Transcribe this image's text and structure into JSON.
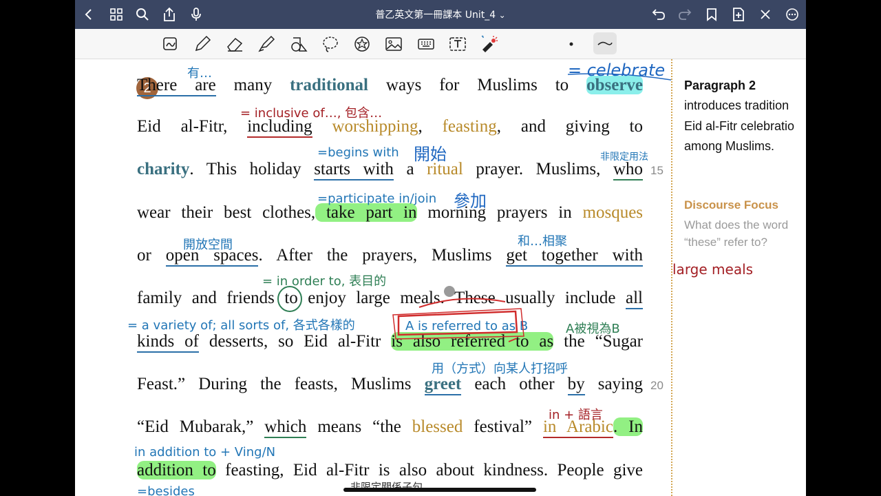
{
  "window": {
    "title": "普乙英文第一冊課本 Unit_4",
    "title_chevron": "⌄"
  },
  "titlebar_icons": [
    "back-chevron-icon",
    "grid-icon",
    "search-icon",
    "share-icon",
    "microphone-icon",
    "undo-icon",
    "redo-icon",
    "bookmark-icon",
    "add-page-icon",
    "close-pen-icon",
    "more-icon"
  ],
  "toolbar_icons": [
    "scan-icon",
    "pen-icon",
    "eraser-icon",
    "highlighter-icon",
    "shapes-icon",
    "lasso-icon",
    "sticker-icon",
    "image-icon",
    "keyboard-icon",
    "text-box-icon",
    "laser-pointer-icon",
    "dot-size-icon",
    "stroke-style-icon"
  ],
  "colors": {
    "titlebar": "#3a4663",
    "accent_teal": "#3a7080",
    "gold": "#b88a2a",
    "note_blue": "#2276b6",
    "note_red": "#a31f24",
    "highlight_green": "#6eeb5a"
  },
  "paragraph": {
    "number": "2",
    "lines": [
      {
        "parts": [
          "There are",
          " many ",
          "traditional",
          " ways for Muslims to ",
          "observe"
        ]
      },
      {
        "parts": [
          "Eid al-Fitr, ",
          "including",
          " ",
          "worshipping",
          ", ",
          "feasting",
          ", and giving to"
        ]
      },
      {
        "parts": [
          "charity",
          ". This holiday ",
          "starts with",
          " a ",
          "ritual",
          " prayer. Muslims, ",
          "who"
        ]
      },
      {
        "parts": [
          "wear their best clothes,",
          " take part in",
          " morning prayers in ",
          "mosques"
        ]
      },
      {
        "parts": [
          "or ",
          "open spaces",
          ". After the prayers, Muslims ",
          "get together with"
        ]
      },
      {
        "parts": [
          "family and friends ",
          "to",
          " enjoy large meals. These usually include ",
          "all"
        ]
      },
      {
        "parts": [
          "kinds of",
          " desserts, so Eid al-Fitr ",
          "is also referred to as",
          " the “Sugar"
        ]
      },
      {
        "parts": [
          "Feast.” During the feasts, Muslims ",
          "greet",
          " each other ",
          "by",
          " saying"
        ]
      },
      {
        "parts": [
          "“Eid Mubarak,” ",
          "which",
          " means “the ",
          "blessed",
          " festival” ",
          "in Arabic",
          ". In"
        ]
      },
      {
        "parts": [
          "addition to",
          " feasting, Eid al-Fitr is also about kindness. People give"
        ]
      }
    ],
    "line_numbers": [
      "15",
      "20"
    ]
  },
  "annotations": {
    "a1": "有…",
    "a2": "= celebrate",
    "a3": "= inclusive of…, 包含…",
    "a4": "=begins with",
    "a5": "開始",
    "a6": "非限定用法",
    "a7": "=participate in/join",
    "a8": "參加",
    "a9": "開放空間",
    "a10": "和…相聚",
    "a11": "= in order to, 表目的",
    "a12": "= a variety of; all sorts of, 各式各樣的",
    "a13": "A is referred to as B",
    "a14": "A被視為B",
    "a15": "用（方式）向某人打招呼",
    "a16": "in + 語言",
    "a17": "in addition to + Ving/N",
    "a18": "=besides",
    "a19": "非限定關係子句"
  },
  "sidebar": {
    "heading": "Paragraph 2",
    "body_lines": [
      "introduces tradition",
      "Eid al-Fitr celebratio",
      "among Muslims."
    ],
    "focus_heading": "Discourse Focus",
    "focus_lines": [
      "What does the word",
      "“these” refer to?"
    ],
    "handwritten_answer": "large meals"
  }
}
